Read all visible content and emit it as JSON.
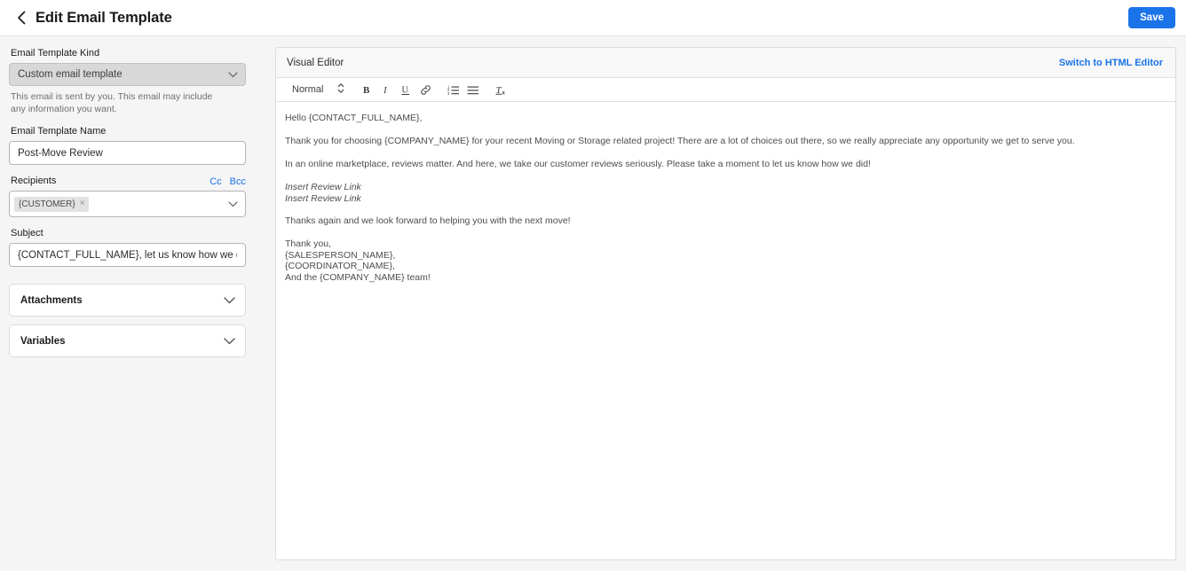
{
  "header": {
    "back_icon": "chevron-left-icon",
    "title": "Edit Email Template",
    "save_label": "Save",
    "accent_color": "#1a73e8"
  },
  "sidebar": {
    "kind": {
      "label": "Email Template Kind",
      "value": "Custom email template",
      "helper": "This email is sent by you. This email may include any information you want."
    },
    "name": {
      "label": "Email Template Name",
      "value": "Post-Move Review"
    },
    "recipients": {
      "label": "Recipients",
      "cc_label": "Cc",
      "bcc_label": "Bcc",
      "chips": [
        {
          "text": "{CUSTOMER}",
          "remove": "×"
        }
      ]
    },
    "subject": {
      "label": "Subject",
      "value": "{CONTACT_FULL_NAME}, let us know how we did!"
    },
    "accordions": [
      {
        "label": "Attachments"
      },
      {
        "label": "Variables"
      }
    ]
  },
  "editor": {
    "header_title": "Visual Editor",
    "switch_link": "Switch to HTML Editor",
    "toolbar": {
      "style_value": "Normal",
      "buttons": [
        {
          "name": "bold-button",
          "glyph": "B"
        },
        {
          "name": "italic-button",
          "glyph": "I"
        },
        {
          "name": "underline-button",
          "glyph": "U"
        },
        {
          "name": "link-button",
          "glyph": "link-icon"
        },
        {
          "name": "ordered-list-button",
          "glyph": "ordered-list-icon"
        },
        {
          "name": "bullet-list-button",
          "glyph": "bullet-list-icon"
        },
        {
          "name": "clear-format-button",
          "glyph": "clear-format-icon"
        }
      ]
    },
    "body": {
      "greeting": "Hello {CONTACT_FULL_NAME},",
      "paragraph_1": "Thank you for choosing {COMPANY_NAME} for your recent Moving or Storage related project! There are a lot of choices out there, so we really appreciate any opportunity we get to serve you.",
      "paragraph_2": "In an online marketplace, reviews matter. And here, we take our customer reviews seriously. Please take a moment to let us know how we did!",
      "review_link_1": "Insert Review Link",
      "review_link_2": "Insert Review Link",
      "paragraph_3": "Thanks again and we look forward to helping you with the next move!",
      "sign_off": "Thank you,",
      "signature_1": "{SALESPERSON_NAME},",
      "signature_2": "{COORDINATOR_NAME},",
      "signature_3": "And the {COMPANY_NAME} team!"
    }
  }
}
